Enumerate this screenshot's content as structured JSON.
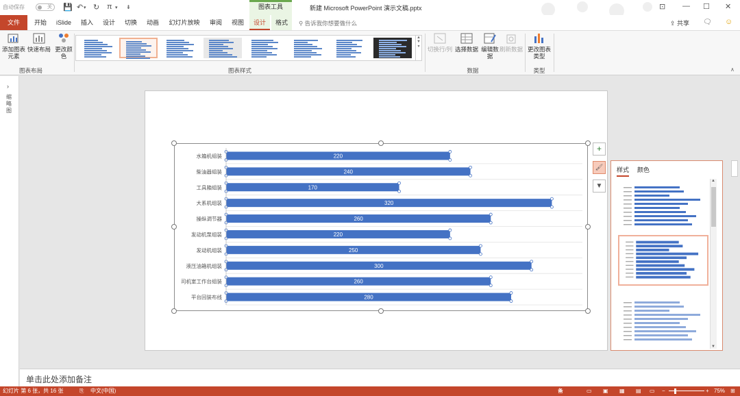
{
  "titlebar": {
    "autosave_label": "自动保存",
    "autosave_state": "关",
    "context_group": "图表工具",
    "doc_title": "新建 Microsoft PowerPoint 演示文稿.pptx"
  },
  "tabs": [
    "文件",
    "开始",
    "iSlide",
    "插入",
    "设计",
    "切换",
    "动画",
    "幻灯片放映",
    "审阅",
    "视图",
    "设计",
    "格式"
  ],
  "tell_me": "告诉我你想要做什么",
  "share_label": "共享",
  "ribbon": {
    "add_element": "添加图表元素",
    "quick_layout": "快速布局",
    "change_color": "更改颜色",
    "group_layout": "图表布局",
    "group_styles": "图表样式",
    "switch_row_col": "切换行/列",
    "select_data": "选择数据",
    "edit_data": "编辑数据",
    "refresh_data": "刷新数据",
    "group_data": "数据",
    "change_type": "更改图表类型",
    "group_type": "类型"
  },
  "left_panel": {
    "label": "缩略图"
  },
  "chart_data": {
    "type": "bar",
    "categories": [
      "水箱机组装",
      "柴油器组装",
      "工具箱组装",
      "大系机组装",
      "操纵调节器",
      "发动机泵组装",
      "发动机组装",
      "液压油箱机组装",
      "司机室工作台组装",
      "平台回装布线"
    ],
    "values": [
      220,
      240,
      170,
      320,
      260,
      220,
      250,
      300,
      260,
      280
    ],
    "xlim": [
      0,
      350
    ],
    "bar_color": "#4472c4",
    "grid": true
  },
  "style_pane": {
    "tab_style": "样式",
    "tab_color": "颜色"
  },
  "notes_placeholder": "单击此处添加备注",
  "status": {
    "slide_info": "幻灯片 第 6 张，共 16 张",
    "language": "中文(中国)",
    "notes": "备注",
    "zoom": "75%"
  },
  "colors": {
    "accent": "#c4462b",
    "context": "#eaf5e4",
    "bar": "#4472c4"
  }
}
